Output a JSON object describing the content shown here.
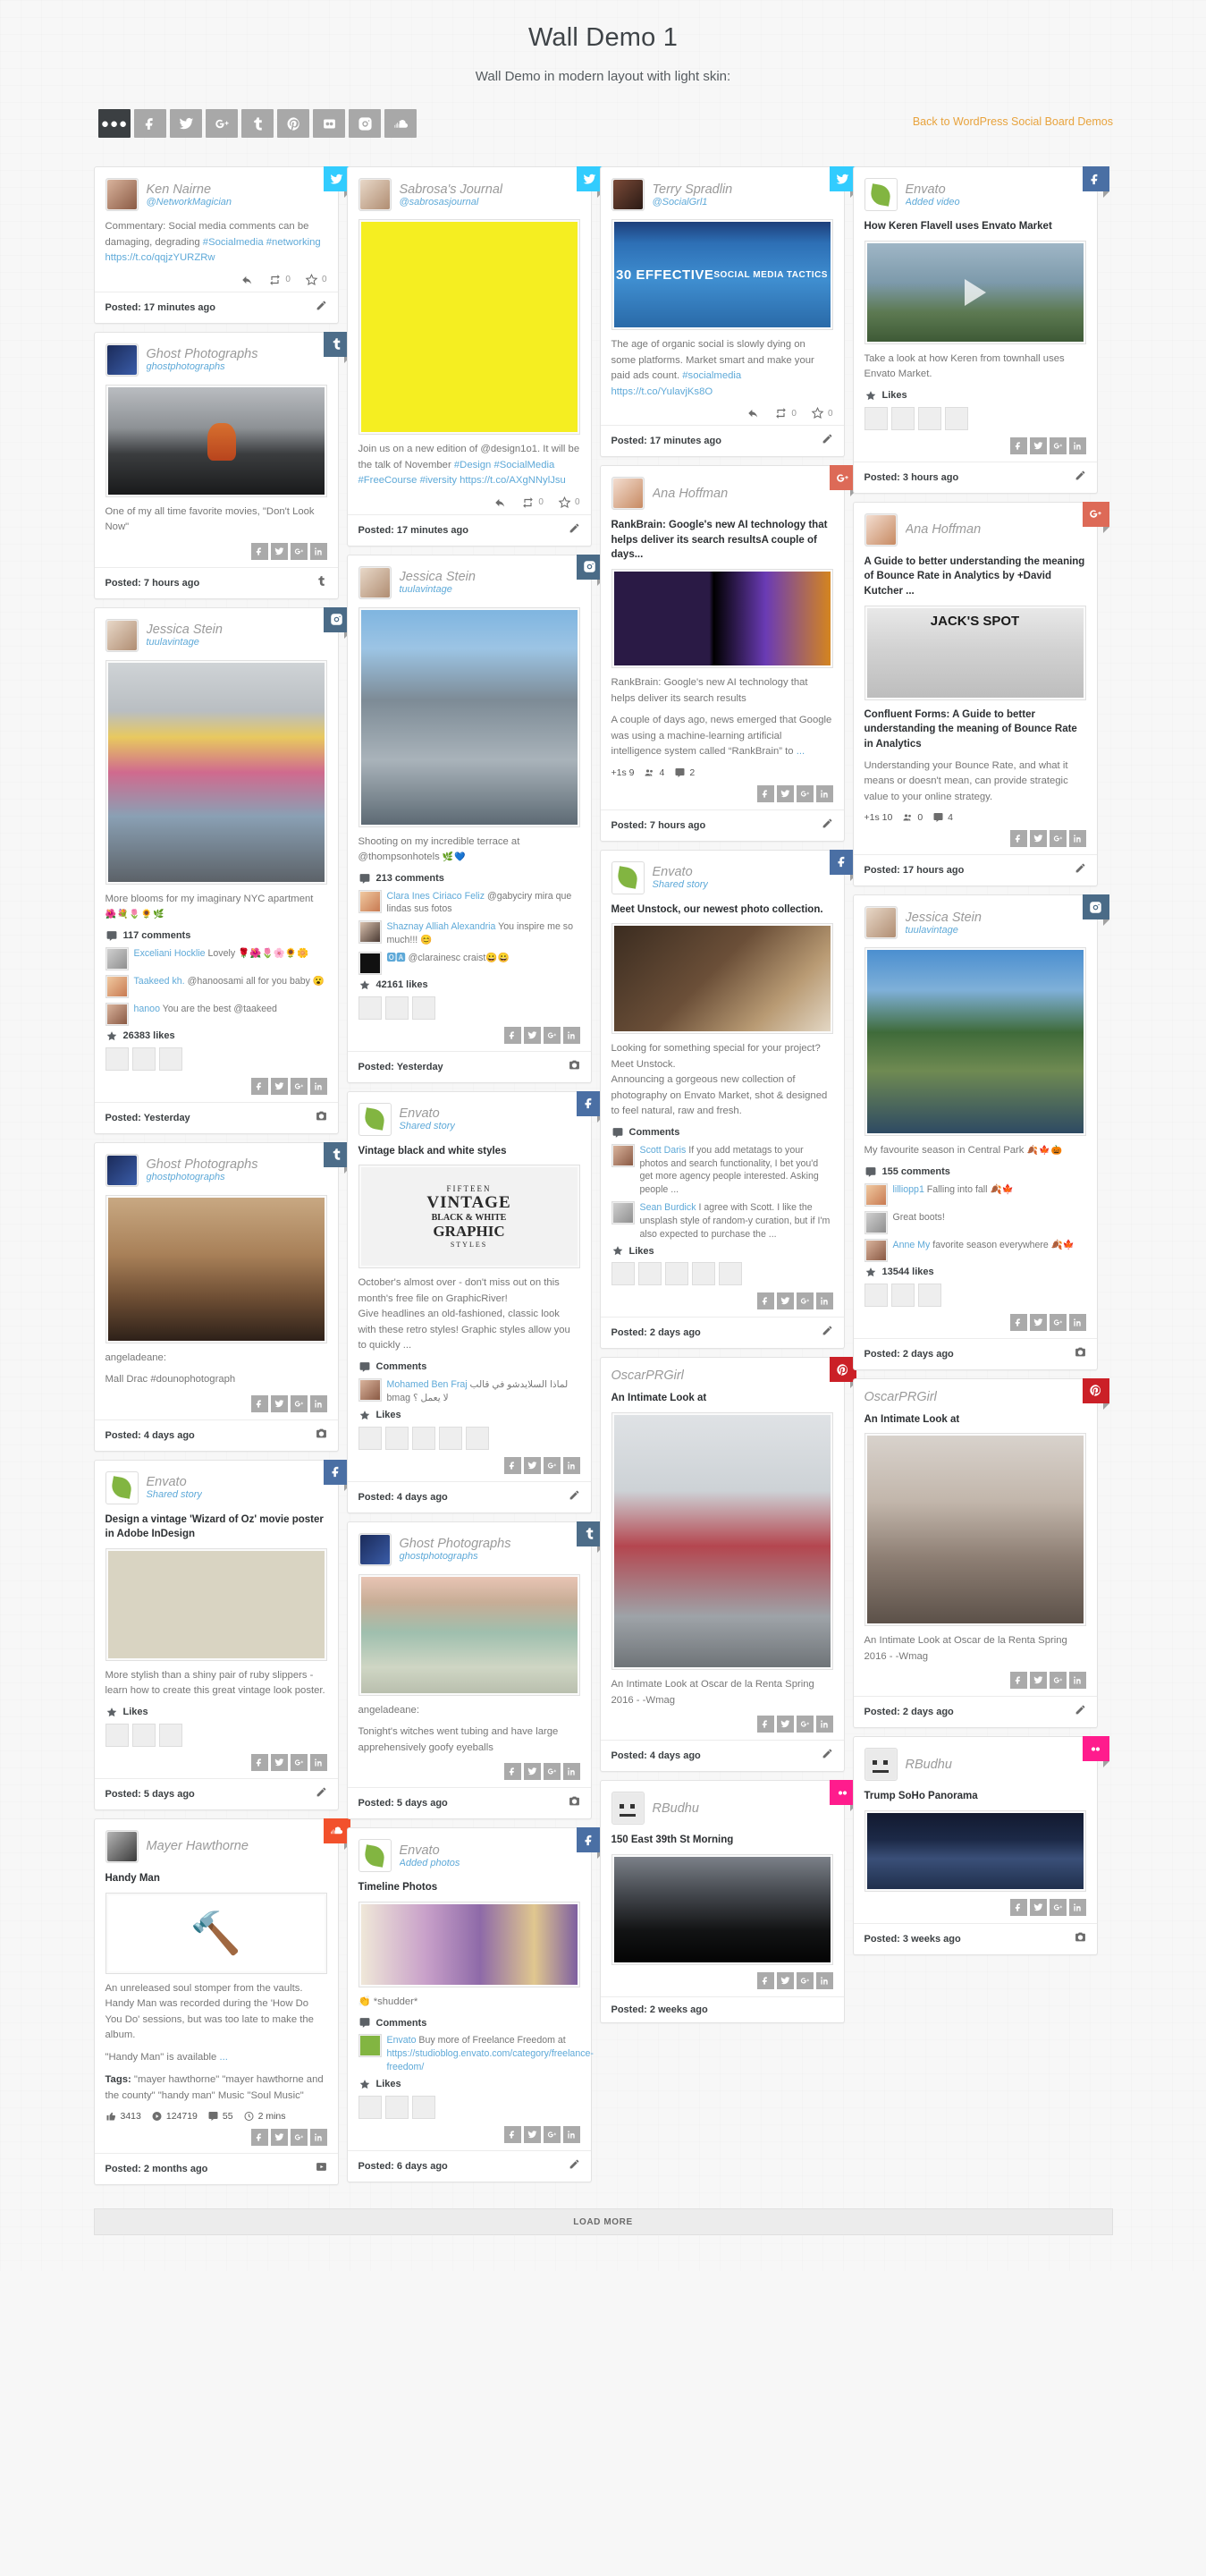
{
  "header": {
    "title": "Wall Demo 1",
    "subtitle": "Wall Demo in modern layout with light skin:",
    "back_link": "Back to WordPress Social Board Demos"
  },
  "filter_bar": {
    "buttons": [
      {
        "name": "all",
        "icon": "ellipsis-icon",
        "active": true
      },
      {
        "name": "facebook",
        "icon": "facebook-icon",
        "active": false
      },
      {
        "name": "twitter",
        "icon": "twitter-icon",
        "active": false
      },
      {
        "name": "googleplus",
        "icon": "google-plus-icon",
        "active": false
      },
      {
        "name": "tumblr",
        "icon": "tumblr-icon",
        "active": false
      },
      {
        "name": "pinterest",
        "icon": "pinterest-icon",
        "active": false
      },
      {
        "name": "flickr",
        "icon": "flickr-icon",
        "active": false
      },
      {
        "name": "instagram",
        "icon": "instagram-icon",
        "active": false
      },
      {
        "name": "soundcloud",
        "icon": "soundcloud-icon",
        "active": false
      }
    ]
  },
  "load_more": "LOAD MORE",
  "share_networks": [
    "facebook",
    "twitter",
    "googleplus",
    "linkedin"
  ],
  "colors": {
    "twitter": "#32ccfe",
    "facebook": "#4a6fa4",
    "tumblr": "#4d6d89",
    "instagram": "#4a6b87",
    "googleplus": "#dd6a57",
    "pinterest": "#cb2027",
    "flickr": "#ff1c8d",
    "soundcloud": "#f2512c",
    "link": "#5ea9d8",
    "accent_orange": "#e8a33d"
  },
  "cards": {
    "c1": {
      "author": "Ken Nairne",
      "handle": "@NetworkMagician",
      "text": "Commentary: Social media comments can be damaging, degrading ",
      "tag1": "#Socialmedia #networking",
      "url": " https://t.co/qqjzYURZRw",
      "retweets": "0",
      "favorites": "0",
      "posted": "Posted: 17 minutes ago"
    },
    "c2": {
      "author": "Ghost Photographs",
      "handle": "ghostphotographs",
      "text": "One of my all time favorite movies, \"Don't Look Now\"",
      "posted": "Posted: 7 hours ago"
    },
    "c3": {
      "author": "Jessica Stein",
      "handle": "tuulavintage",
      "text": "More blooms for my imaginary NYC apartment ",
      "emoji": "🌺💐🌷🌻🌿",
      "comments_label": "117 comments",
      "comments": [
        {
          "who": "Exceliani Hocklie",
          "body": " Lovely 🌹🌺🌷🌸🌻🌼"
        },
        {
          "who": "Taakeed kh.",
          "body": " @hanoosami all for you baby 😮"
        },
        {
          "who": "hanoo",
          "body": " You are the best @taakeed"
        }
      ],
      "likes_label": "26383 likes",
      "posted": "Posted: Yesterday"
    },
    "c4": {
      "author": "Ghost Photographs",
      "handle": "ghostphotographs",
      "text1": "angeladeane:",
      "text2": "Mall Drac #dounophotograph",
      "posted": "Posted: 4 days ago"
    },
    "c5": {
      "author": "Envato",
      "handle": "Shared story",
      "title": "Design a vintage 'Wizard of Oz' movie poster in Adobe InDesign",
      "text": "More stylish than a shiny pair of ruby slippers - learn how to create this great vintage look poster.",
      "likes_head": "Likes",
      "posted": "Posted: 5 days ago"
    },
    "c6": {
      "author": "Mayer Hawthorne",
      "handle": "",
      "title": "Handy Man",
      "text": "An unreleased soul stomper from the vaults. Handy Man was recorded during the 'How Do You Do' sessions, but was too late to make the album.",
      "text2": "\"Handy Man\" is available ",
      "ellipsis": "...",
      "tags_label": "Tags:",
      "tags": " \"mayer hawthorne\" \"mayer hawthorne and the county\" \"handy man\" Music \"Soul Music\"",
      "likes": "3413",
      "plays": "124719",
      "comments": "55",
      "duration": "2 mins",
      "posted": "Posted: 2 months ago"
    },
    "c7": {
      "author": "Sabrosa's Journal",
      "handle": "@sabrosasjournal",
      "text": "Join us on a new edition of @design1o1. It will be the talk of November ",
      "tags": "#Design #SocialMedia #FreeCourse #iversity",
      "url": " https://t.co/AXgNNylJsu",
      "retweets": "0",
      "favorites": "0",
      "posted": "Posted: 17 minutes ago"
    },
    "c8": {
      "author": "Jessica Stein",
      "handle": "tuulavintage",
      "text": "Shooting on my incredible terrace at @thompsonhotels ",
      "emoji": "🌿💙",
      "comments_label": "213 comments",
      "comments": [
        {
          "who": "Clara Ines Ciriaco Feliz",
          "body": " @gabyciry mira que lindas sus fotos"
        },
        {
          "who": "Shaznay Alliah Alexandria",
          "body": " You inspire me so much!!! 😊"
        },
        {
          "who": "🅾🅰",
          "body": " @clarainesc craist😀😀"
        }
      ],
      "likes_label": "42161 likes",
      "posted": "Posted: Yesterday"
    },
    "c9": {
      "author": "Envato",
      "handle": "Shared story",
      "title": "Vintage black and white styles",
      "text": "October's almost over - don't miss out on this month's free file on GraphicRiver!\nGive headlines an old-fashioned, classic look with these retro styles! Graphic styles allow you to quickly ...",
      "comments_head": "Comments",
      "comments": [
        {
          "who": "Mohamed Ben Fraj",
          "body": " لماذا السلايدشو في قالب bmag لا يعمل ؟"
        }
      ],
      "likes_head": "Likes",
      "posted": "Posted: 4 days ago"
    },
    "c10": {
      "author": "Ghost Photographs",
      "handle": "ghostphotographs",
      "text1": "angeladeane:",
      "text2": "Tonight's witches went tubing and have large apprehensively goofy eyeballs",
      "posted": "Posted: 5 days ago"
    },
    "c11": {
      "author": "Envato",
      "handle": "Added photos",
      "title": "Timeline Photos",
      "text": "👏 *shudder*",
      "comments_head": "Comments",
      "comments": [
        {
          "who": "Envato",
          "body": " Buy more of Freelance Freedom at ",
          "link": "https://studioblog.envato.com/category/freelance-freedom/"
        }
      ],
      "likes_head": "Likes",
      "posted": "Posted: 6 days ago"
    },
    "c12": {
      "author": "Terry Spradlin",
      "handle": "@SocialGrl1",
      "text": "The age of organic social is slowly dying on some platforms. Market smart and make your paid ads count. ",
      "tags": "#socialmedia",
      "url": " https://t.co/YulavjKs8O",
      "retweets": "0",
      "favorites": "0",
      "posted": "Posted: 17 minutes ago"
    },
    "c13": {
      "author": "Ana Hoffman",
      "handle": "",
      "title": "RankBrain: Google's new AI technology that helps deliver its search resultsA couple of days...",
      "text1": "RankBrain: Google's new AI technology that helps deliver its search results",
      "text2": "A couple of days ago, news emerged that Google was using a machine-learning artificial intelligence system called “RankBrain” to ",
      "ellipsis": "...",
      "plus_ones": "+1s 9",
      "shares": "4",
      "comments": "2",
      "posted": "Posted: 7 hours ago"
    },
    "c14": {
      "author": "Envato",
      "handle": "Shared story",
      "title": "Meet Unstock, our newest photo collection.",
      "text": "Looking for something special for your project? Meet Unstock.\nAnnouncing a gorgeous new collection of photography on Envato Market, shot & designed to feel natural, raw and fresh.",
      "comments_head": "Comments",
      "comments": [
        {
          "who": "Scott Daris",
          "body": " If you add metatags to your photos and search functionality, I bet you'd get more agency people interested. Asking people ...",
          "link": ""
        },
        {
          "who": "Sean Burdick",
          "body": " I agree with Scott. I like the unsplash style of random-y curation, but if I'm also expected to purchase the ..."
        }
      ],
      "likes_head": "Likes",
      "posted": "Posted: 2 days ago"
    },
    "c15": {
      "author": "OscarPRGirl",
      "handle": "",
      "title": "An Intimate Look at",
      "text": "An Intimate Look at Oscar de la Renta Spring 2016 - -Wmag",
      "posted": "Posted: 4 days ago"
    },
    "c16": {
      "author": "RBudhu",
      "handle": "",
      "title": "150 East 39th St Morning",
      "posted": "Posted: 2 weeks ago"
    },
    "c17": {
      "author": "Envato",
      "handle": "Added video",
      "title": "How Keren Flavell uses Envato Market",
      "text": "Take a look at how Keren from townhall uses Envato Market.",
      "likes_head": "Likes",
      "posted": "Posted: 3 hours ago"
    },
    "c18": {
      "author": "Ana Hoffman",
      "handle": "",
      "title": "A Guide to better understanding the meaning of Bounce Rate in Analytics by +David Kutcher ...",
      "text1": "Confluent Forms: A Guide to better understanding the meaning of Bounce Rate in Analytics",
      "text2": "Understanding your Bounce Rate, and what it means or doesn't mean, can provide strategic value to your online strategy.",
      "ellipsis": "+1s 10",
      "plus_ones": "+1s 10",
      "shares": "0",
      "comments": "4",
      "posted": "Posted: 17 hours ago"
    },
    "c19": {
      "author": "Jessica Stein",
      "handle": "tuulavintage",
      "text": "My favourite season in Central Park ",
      "emoji": "🍂🍁🎃",
      "comments_label": "155 comments",
      "comments": [
        {
          "who": "lilliopp1",
          "body": " Falling into fall 🍂🍁"
        },
        {
          "who": "",
          "body": "Great boots!"
        },
        {
          "who": "Anne My",
          "body": " favorite season everywhere 🍂🍁"
        }
      ],
      "likes_label": "13544 likes",
      "posted": "Posted: 2 days ago"
    },
    "c20": {
      "author": "OscarPRGirl",
      "handle": "",
      "title": "An Intimate Look at",
      "text": "An Intimate Look at Oscar de la Renta Spring 2016 - -Wmag",
      "posted": "Posted: 2 days ago"
    },
    "c21": {
      "author": "RBudhu",
      "handle": "",
      "title": "Trump SoHo Panorama",
      "posted": "Posted: 3 weeks ago"
    }
  }
}
